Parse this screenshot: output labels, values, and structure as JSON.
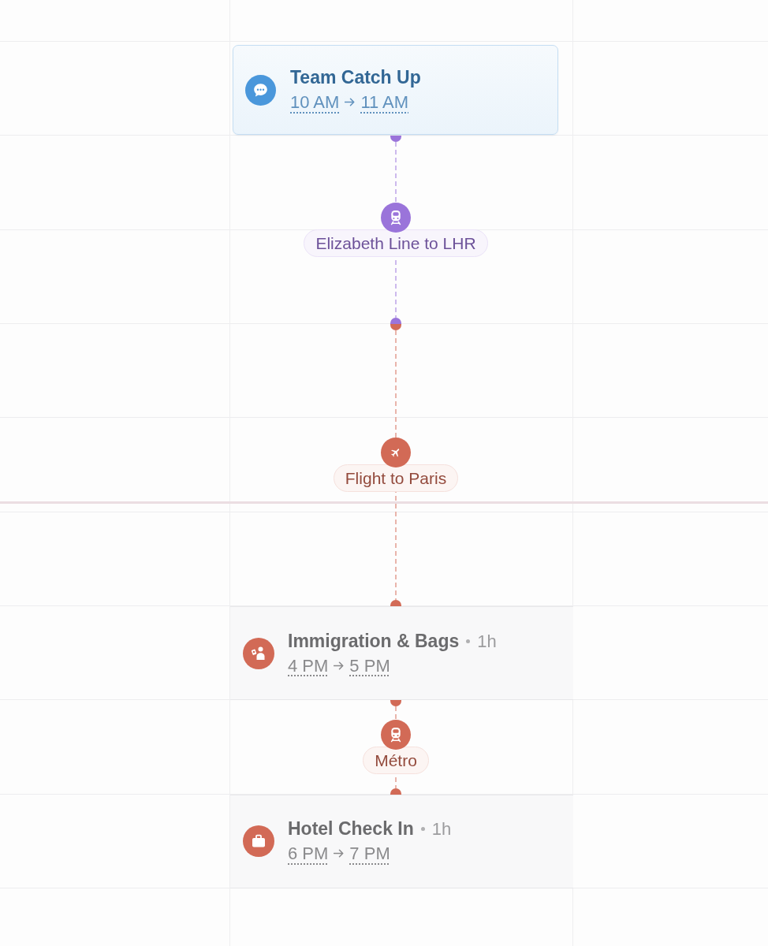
{
  "calendar": {
    "timeline": [
      {
        "kind": "meeting",
        "title": "Team Catch Up",
        "start": "10 AM",
        "end": "11 AM",
        "color": "#4a97db"
      },
      {
        "kind": "train",
        "label": "Elizabeth Line to LHR",
        "color": "#9a74da"
      },
      {
        "kind": "flight",
        "label": "Flight to Paris",
        "color": "#d26a56"
      },
      {
        "kind": "immigration",
        "title": "Immigration & Bags",
        "duration": "1h",
        "start": "4 PM",
        "end": "5 PM",
        "color": "#d26a56"
      },
      {
        "kind": "train",
        "label": "Métro",
        "color": "#d26a56"
      },
      {
        "kind": "hotel",
        "title": "Hotel Check In",
        "duration": "1h",
        "start": "6 PM",
        "end": "7 PM",
        "color": "#d26a56"
      }
    ]
  }
}
